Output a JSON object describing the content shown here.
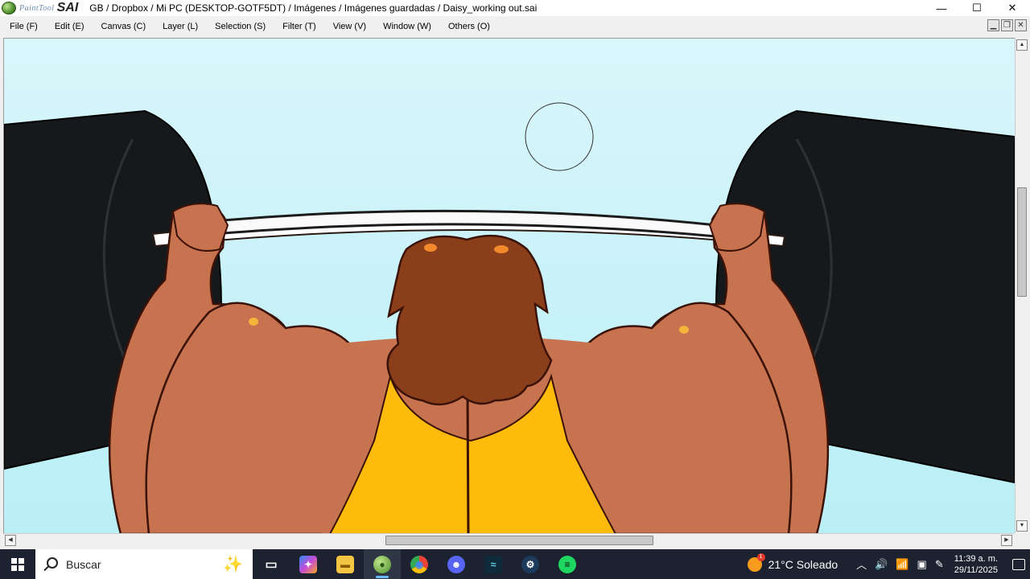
{
  "app": {
    "logo_small": "PaintTool",
    "logo_big": "SAI",
    "title": "GB / Dropbox / Mi PC (DESKTOP-GOTF5DT) / Imágenes / Imágenes guardadas / Daisy_working out.sai"
  },
  "window_controls": {
    "minimize": "—",
    "maximize": "☐",
    "close": "✕"
  },
  "menu": [
    {
      "label": "File (F)"
    },
    {
      "label": "Edit (E)"
    },
    {
      "label": "Canvas (C)"
    },
    {
      "label": "Layer (L)"
    },
    {
      "label": "Selection (S)"
    },
    {
      "label": "Filter (T)"
    },
    {
      "label": "View (V)"
    },
    {
      "label": "Window (W)"
    },
    {
      "label": "Others (O)"
    }
  ],
  "mdi_controls": {
    "minimize": "▁",
    "restore": "❐",
    "close": "✕"
  },
  "scrollbars": {
    "up": "▲",
    "down": "▼",
    "left": "◀",
    "right": "▶"
  },
  "canvas": {
    "background_color": "#c9f3f8",
    "skin_color": "#c8734f",
    "hair_color": "#8a3f1a",
    "shirt_color": "#ffbb0b",
    "weight_color": "#16191c"
  },
  "taskbar": {
    "search_placeholder": "Buscar",
    "icons": [
      {
        "name": "task-view-icon",
        "glyph": "▭"
      },
      {
        "name": "copilot-icon",
        "glyph": "✦"
      },
      {
        "name": "file-explorer-icon",
        "glyph": "▬"
      },
      {
        "name": "painttool-sai-icon",
        "glyph": "●"
      },
      {
        "name": "chrome-icon",
        "glyph": "◉"
      },
      {
        "name": "discord-icon",
        "glyph": "☻"
      },
      {
        "name": "terminal-icon",
        "glyph": "≈"
      },
      {
        "name": "steam-icon",
        "glyph": "⚙"
      },
      {
        "name": "spotify-icon",
        "glyph": "≡"
      }
    ],
    "weather": {
      "badge": "1",
      "text": "21°C  Soleado"
    },
    "clock": {
      "time": "11:39 a. m.",
      "date": "29/11/2025"
    }
  }
}
